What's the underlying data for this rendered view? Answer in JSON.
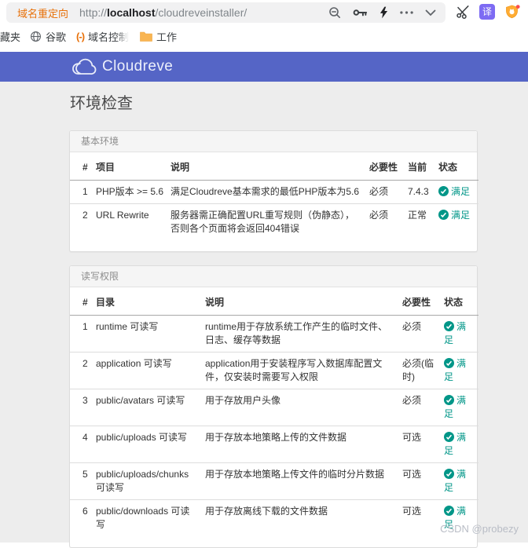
{
  "browser": {
    "address_bar": {
      "label": "域名重定向",
      "scheme": "http://",
      "host": "localhost",
      "path": "/cloudreveinstaller/"
    },
    "toolbar_icons": [
      "zoom-out",
      "key",
      "lightning",
      "more-dots",
      "chevron-down"
    ],
    "external_icons": [
      "scissors",
      "translate",
      "shield"
    ],
    "translate_glyph": "译",
    "bookmarks": [
      {
        "label": "藏夹",
        "icon": "none"
      },
      {
        "label": "谷歌",
        "icon": "globe"
      },
      {
        "label": "域名控制",
        "icon": "domain-brackets",
        "icon_glyph": "(-)"
      },
      {
        "label": "工作",
        "icon": "folder"
      }
    ]
  },
  "header": {
    "brand": "Cloudreve"
  },
  "page": {
    "title": "环境检查",
    "watermark": "CSDN @probezy"
  },
  "panels": [
    {
      "title": "基本环境",
      "columns": [
        "#",
        "项目",
        "说明",
        "必要性",
        "当前",
        "状态"
      ],
      "rows": [
        [
          "1",
          "PHP版本 >= 5.6",
          "满足Cloudreve基本需求的最低PHP版本为5.6",
          "必须",
          "7.4.3",
          "满足"
        ],
        [
          "2",
          "URL Rewrite",
          "服务器需正确配置URL重写规则（伪静态），否则各个页面将会返回404错误",
          "必须",
          "正常",
          "满足"
        ]
      ]
    },
    {
      "title": "读写权限",
      "columns": [
        "#",
        "目录",
        "说明",
        "必要性",
        "状态"
      ],
      "rows": [
        [
          "1",
          "runtime 可读写",
          "runtime用于存放系统工作产生的临时文件、日志、缓存等数据",
          "必须",
          "满足"
        ],
        [
          "2",
          "application 可读写",
          "application用于安装程序写入数据库配置文件，仅安装时需要写入权限",
          "必须(临时)",
          "满足"
        ],
        [
          "3",
          "public/avatars 可读写",
          "用于存放用户头像",
          "必须",
          "满足"
        ],
        [
          "4",
          "public/uploads 可读写",
          "用于存放本地策略上传的文件数据",
          "可选",
          "满足"
        ],
        [
          "5",
          "public/uploads/chunks 可读写",
          "用于存放本地策略上传文件的临时分片数据",
          "可选",
          "满足"
        ],
        [
          "6",
          "public/downloads 可读写",
          "用于存放离线下载的文件数据",
          "可选",
          "满足"
        ]
      ]
    }
  ],
  "colors": {
    "accent": "#5565c6",
    "success": "#009688",
    "address_label_orange": "#e8710a",
    "translate_badge": "#7d6bf3",
    "shield_orange": "#ffac33",
    "folder_yellow": "#f9b552"
  }
}
